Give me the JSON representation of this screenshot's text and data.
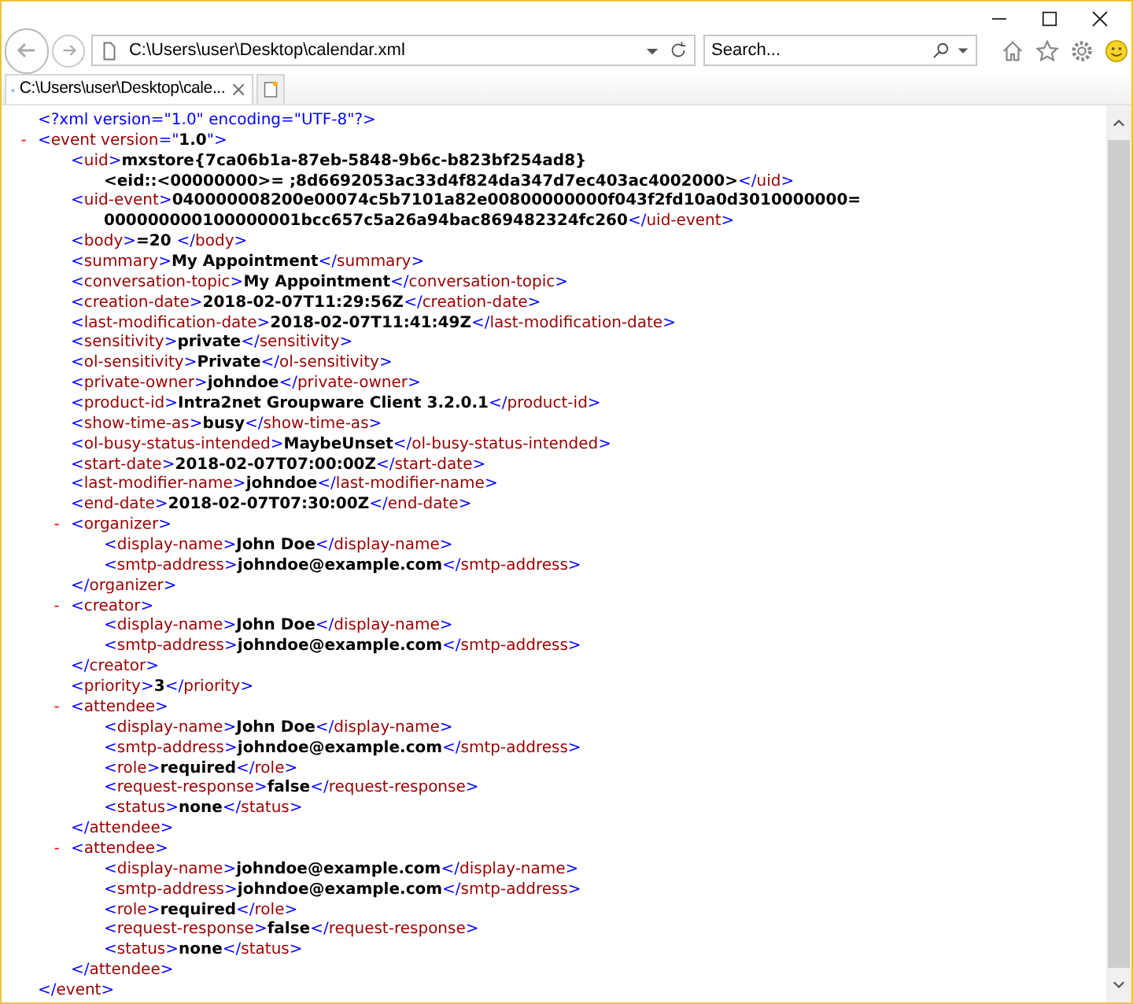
{
  "browser": {
    "address": "C:\\Users\\user\\Desktop\\calendar.xml",
    "search": {
      "placeholder": "Search..."
    },
    "tabs": [
      {
        "title": "C:\\Users\\user\\Desktop\\cale...",
        "close": "×",
        "selected": true
      }
    ]
  },
  "document": {
    "declaration": "<?xml version=\"1.0\" encoding=\"UTF-8\"?>",
    "root": {
      "kind": "element",
      "open": "<event version=\"1.0\">",
      "close": "</event>",
      "toggle": "-",
      "expanded": true,
      "children": [
        {
          "kind": "leaf",
          "open": "<uid>",
          "value_lines": [
            "mxstore{7ca06b1a-87eb-5848-9b6c-b823bf254ad8}",
            "<eid::<00000000>= ;8d6692053ac33d4f824da347d7ec403ac4002000>"
          ],
          "close": "</uid>"
        },
        {
          "kind": "leaf",
          "open": "<uid-event>",
          "value_lines": [
            "040000008200e00074c5b7101a82e00800000000f043f2fd10a0d3010000000=",
            "000000000100000001bcc657c5a26a94bac869482324fc260"
          ],
          "close": "</uid-event>"
        },
        {
          "kind": "leaf",
          "open": "<body>",
          "value_lines": [
            "=20 "
          ],
          "close": "</body>"
        },
        {
          "kind": "leaf",
          "open": "<summary>",
          "value_lines": [
            "My Appointment"
          ],
          "close": "</summary>"
        },
        {
          "kind": "leaf",
          "open": "<conversation-topic>",
          "value_lines": [
            "My Appointment"
          ],
          "close": "</conversation-topic>"
        },
        {
          "kind": "leaf",
          "open": "<creation-date>",
          "value_lines": [
            "2018-02-07T11:29:56Z"
          ],
          "close": "</creation-date>"
        },
        {
          "kind": "leaf",
          "open": "<last-modification-date>",
          "value_lines": [
            "2018-02-07T11:41:49Z"
          ],
          "close": "</last-modification-date>"
        },
        {
          "kind": "leaf",
          "open": "<sensitivity>",
          "value_lines": [
            "private"
          ],
          "close": "</sensitivity>"
        },
        {
          "kind": "leaf",
          "open": "<ol-sensitivity>",
          "value_lines": [
            "Private"
          ],
          "close": "</ol-sensitivity>"
        },
        {
          "kind": "leaf",
          "open": "<private-owner>",
          "value_lines": [
            "johndoe"
          ],
          "close": "</private-owner>"
        },
        {
          "kind": "leaf",
          "open": "<product-id>",
          "value_lines": [
            "Intra2net Groupware Client 3.2.0.1"
          ],
          "close": "</product-id>"
        },
        {
          "kind": "leaf",
          "open": "<show-time-as>",
          "value_lines": [
            "busy"
          ],
          "close": "</show-time-as>"
        },
        {
          "kind": "leaf",
          "open": "<ol-busy-status-intended>",
          "value_lines": [
            "MaybeUnset"
          ],
          "close": "</ol-busy-status-intended>"
        },
        {
          "kind": "leaf",
          "open": "<start-date>",
          "value_lines": [
            "2018-02-07T07:00:00Z"
          ],
          "close": "</start-date>"
        },
        {
          "kind": "leaf",
          "open": "<last-modifier-name>",
          "value_lines": [
            "johndoe"
          ],
          "close": "</last-modifier-name>"
        },
        {
          "kind": "leaf",
          "open": "<end-date>",
          "value_lines": [
            "2018-02-07T07:30:00Z"
          ],
          "close": "</end-date>"
        },
        {
          "kind": "element",
          "open": "<organizer>",
          "close": "</organizer>",
          "toggle": "-",
          "expanded": true,
          "children": [
            {
              "kind": "leaf",
              "open": "<display-name>",
              "value_lines": [
                "John Doe"
              ],
              "close": "</display-name>"
            },
            {
              "kind": "leaf",
              "open": "<smtp-address>",
              "value_lines": [
                "johndoe@example.com"
              ],
              "close": "</smtp-address>"
            }
          ]
        },
        {
          "kind": "element",
          "open": "<creator>",
          "close": "</creator>",
          "toggle": "-",
          "expanded": true,
          "children": [
            {
              "kind": "leaf",
              "open": "<display-name>",
              "value_lines": [
                "John Doe"
              ],
              "close": "</display-name>"
            },
            {
              "kind": "leaf",
              "open": "<smtp-address>",
              "value_lines": [
                "johndoe@example.com"
              ],
              "close": "</smtp-address>"
            }
          ]
        },
        {
          "kind": "leaf",
          "open": "<priority>",
          "value_lines": [
            "3"
          ],
          "close": "</priority>"
        },
        {
          "kind": "element",
          "open": "<attendee>",
          "close": "</attendee>",
          "toggle": "-",
          "expanded": true,
          "children": [
            {
              "kind": "leaf",
              "open": "<display-name>",
              "value_lines": [
                "John Doe"
              ],
              "close": "</display-name>"
            },
            {
              "kind": "leaf",
              "open": "<smtp-address>",
              "value_lines": [
                "johndoe@example.com"
              ],
              "close": "</smtp-address>"
            },
            {
              "kind": "leaf",
              "open": "<role>",
              "value_lines": [
                "required"
              ],
              "close": "</role>"
            },
            {
              "kind": "leaf",
              "open": "<request-response>",
              "value_lines": [
                "false"
              ],
              "close": "</request-response>"
            },
            {
              "kind": "leaf",
              "open": "<status>",
              "value_lines": [
                "none"
              ],
              "close": "</status>"
            }
          ]
        },
        {
          "kind": "element",
          "open": "<attendee>",
          "close": "</attendee>",
          "toggle": "-",
          "expanded": true,
          "children": [
            {
              "kind": "leaf",
              "open": "<display-name>",
              "value_lines": [
                "johndoe@example.com"
              ],
              "close": "</display-name>"
            },
            {
              "kind": "leaf",
              "open": "<smtp-address>",
              "value_lines": [
                "johndoe@example.com"
              ],
              "close": "</smtp-address>"
            },
            {
              "kind": "leaf",
              "open": "<role>",
              "value_lines": [
                "required"
              ],
              "close": "</role>"
            },
            {
              "kind": "leaf",
              "open": "<request-response>",
              "value_lines": [
                "false"
              ],
              "close": "</request-response>"
            },
            {
              "kind": "leaf",
              "open": "<status>",
              "value_lines": [
                "none"
              ],
              "close": "</status>"
            }
          ]
        }
      ]
    }
  }
}
